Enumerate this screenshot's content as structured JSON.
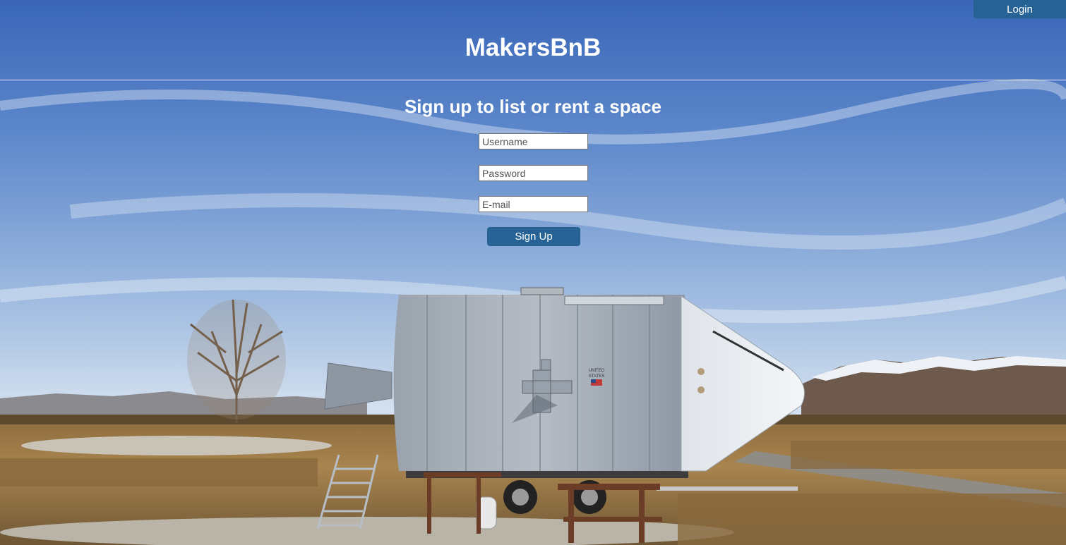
{
  "header": {
    "login_label": "Login",
    "site_title": "MakersBnB"
  },
  "signup": {
    "heading": "Sign up to list or rent a space",
    "username_placeholder": "Username",
    "password_placeholder": "Password",
    "email_placeholder": "E-mail",
    "submit_label": "Sign Up"
  },
  "background": {
    "flag_text_line1": "UNITED",
    "flag_text_line2": "STATES"
  },
  "colors": {
    "button": "#266394",
    "sky_top": "#3f6cbc",
    "sky_bottom": "#d9e3ef"
  }
}
